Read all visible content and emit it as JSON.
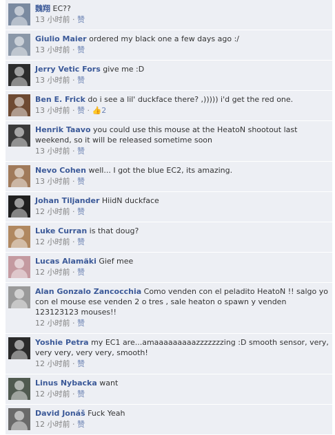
{
  "comments": [
    {
      "author": "魏翔",
      "text": "EC??",
      "time": "13 小时前",
      "like": "赞",
      "avatar_color": "#7a8aa0"
    },
    {
      "author": "Giulio Maier",
      "text": "ordered my black one a few days ago :/",
      "time": "13 小时前",
      "like": "赞",
      "avatar_color": "#8a97a8"
    },
    {
      "author": "Jerry Vetic Fors",
      "text": "give me :D",
      "time": "13 小时前",
      "like": "赞",
      "avatar_color": "#2c2c2c"
    },
    {
      "author": "Ben E. Frick",
      "text": "do i see a lil' duckface there? ,))))) i'd get the red one.",
      "time": "13 小时前",
      "like": "赞",
      "likes_count": "2",
      "avatar_color": "#6e4a32"
    },
    {
      "author": "Henrik Taavo",
      "text": "you could use this mouse at the HeatoN shootout last weekend, so it will be released sometime soon",
      "time": "13 小时前",
      "like": "赞",
      "avatar_color": "#3a3a3a"
    },
    {
      "author": "Nevo Cohen",
      "text": "well... I got the blue EC2, its amazing.",
      "time": "13 小时前",
      "like": "赞",
      "avatar_color": "#a07a5a"
    },
    {
      "author": "Johan Tiljander",
      "text": "HiidN duckface",
      "time": "12 小时前",
      "like": "赞",
      "avatar_color": "#1f1f1f"
    },
    {
      "author": "Luke Curran",
      "text": "is that doug?",
      "time": "12 小时前",
      "like": "赞",
      "avatar_color": "#b08860"
    },
    {
      "author": "Lucas Alamäki",
      "text": "Gief mee",
      "time": "12 小时前",
      "like": "赞",
      "avatar_color": "#c49aa0"
    },
    {
      "author": "Alan Gonzalo Zancocchia",
      "text": "Como venden con el peladito HeatoN !! salgo yo con el mouse ese venden 2 o tres , sale heaton o spawn y venden 123123123 mouses!!",
      "time": "12 小时前",
      "like": "赞",
      "avatar_color": "#9a9a9a"
    },
    {
      "author": "Yoshie Petra",
      "text": "my EC1 are...amaaaaaaaaazzzzzzzing :D smooth sensor, very, very very, very very, smooth!",
      "time": "12 小时前",
      "like": "赞",
      "avatar_color": "#2a2a2a"
    },
    {
      "author": "Linus Nybacka",
      "text": "want",
      "time": "12 小时前",
      "like": "赞",
      "avatar_color": "#505a50"
    },
    {
      "author": "David Jonáš",
      "text": "Fuck Yeah",
      "time": "12 小时前",
      "like": "赞",
      "avatar_color": "#6a6a6a"
    }
  ],
  "meta_separator": " · ",
  "thumb_glyph": "👍"
}
